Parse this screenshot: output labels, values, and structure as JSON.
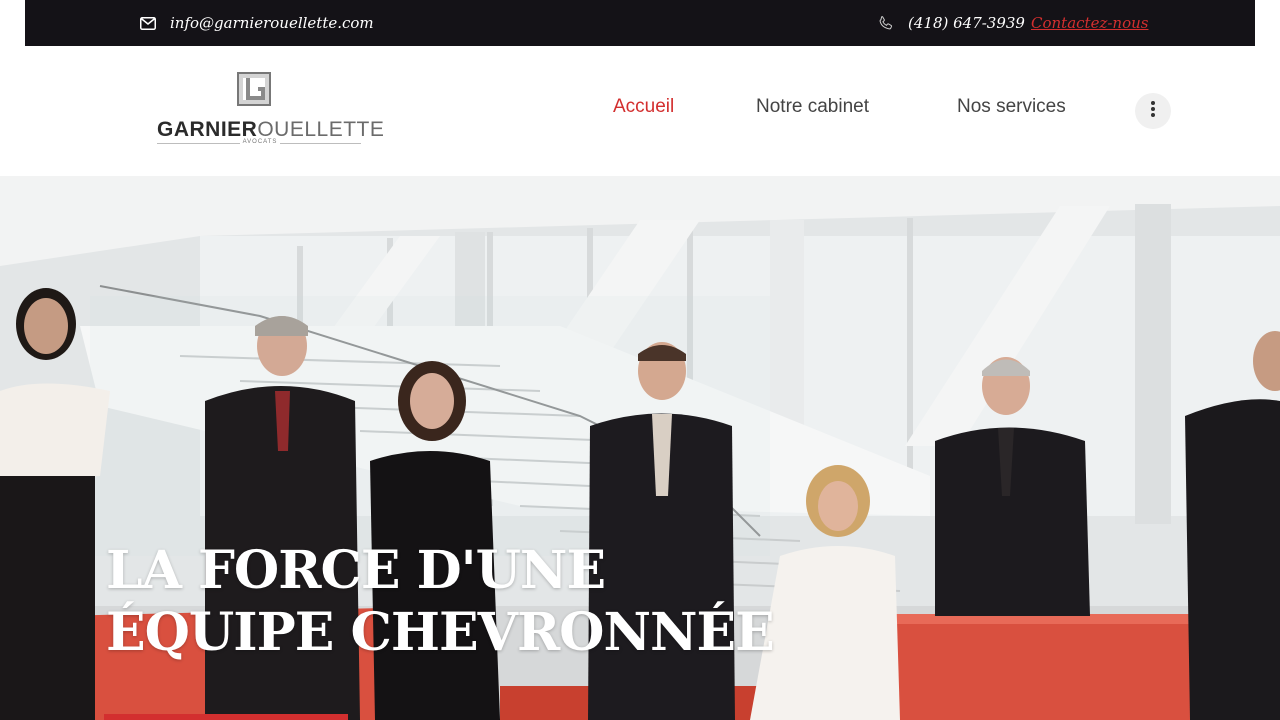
{
  "topbar": {
    "email": "info@garnierouellette.com",
    "phone": "(418) 647-3939",
    "contact_label": "Contactez-nous",
    "icons": {
      "email": "envelope-icon",
      "phone": "phone-icon"
    }
  },
  "brand": {
    "name_bold": "GARNIER",
    "name_light": "OUELLETTE",
    "tagline": "AVOCATS"
  },
  "nav": {
    "items": [
      {
        "label": "Accueil",
        "active": true
      },
      {
        "label": "Notre cabinet",
        "active": false
      },
      {
        "label": "Nos services",
        "active": false
      }
    ],
    "more_icon": "vertical-dots-icon"
  },
  "hero": {
    "title_line1": "LA FORCE D'UNE",
    "title_line2": "ÉQUIPE CHEVRONNÉE"
  },
  "colors": {
    "accent": "#d32f2f",
    "topbar_bg": "#141217",
    "sofa": "#d9503f"
  }
}
